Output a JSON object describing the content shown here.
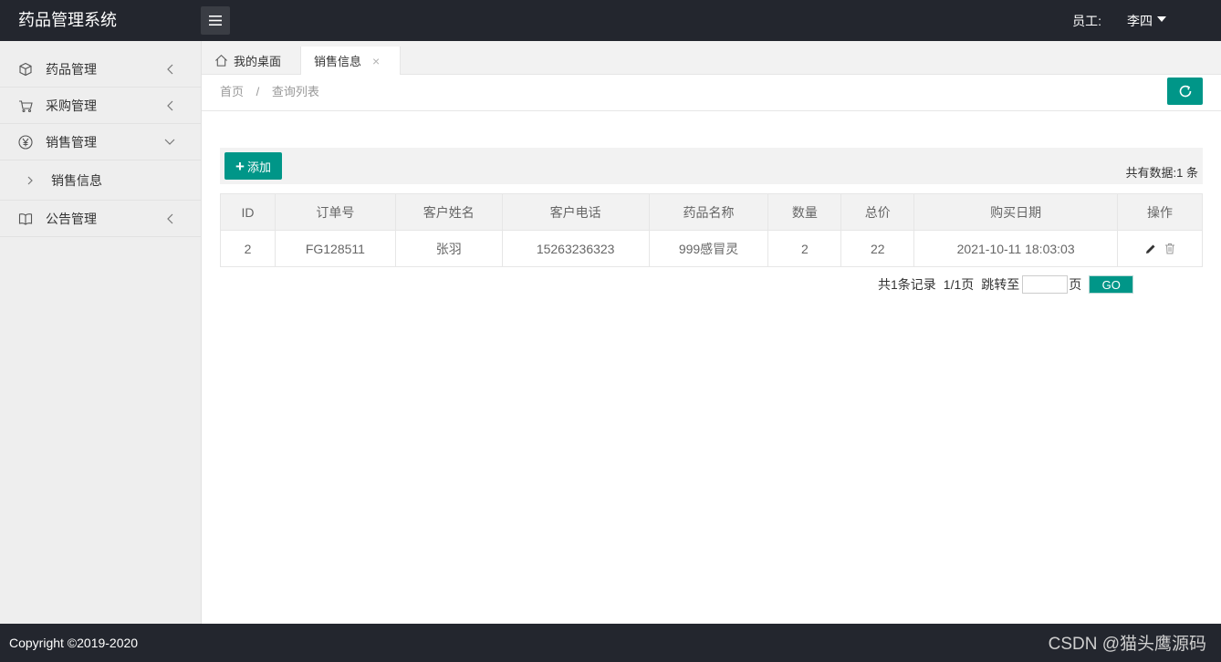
{
  "header": {
    "logo": "药品管理系统",
    "role_label": "员工:",
    "user_name": "李四"
  },
  "sidebar": {
    "items": [
      {
        "label": "药品管理",
        "icon": "cube-icon",
        "arrow": "chevron-left-icon"
      },
      {
        "label": "采购管理",
        "icon": "cart-icon",
        "arrow": "chevron-left-icon"
      },
      {
        "label": "销售管理",
        "icon": "yen-icon",
        "arrow": "chevron-down-icon"
      },
      {
        "label": "公告管理",
        "icon": "book-icon",
        "arrow": "chevron-left-icon"
      }
    ],
    "sub_items": [
      {
        "label": "销售信息",
        "icon": "chevron-right-icon"
      }
    ]
  },
  "tabs": {
    "home_label": "我的桌面",
    "active_label": "销售信息",
    "close_glyph": "×"
  },
  "breadcrumb": {
    "home": "首页",
    "separator": "/",
    "current": "查询列表"
  },
  "toolbar": {
    "add_label": "添加",
    "total_text": "共有数据:1 条"
  },
  "table": {
    "headers": [
      "ID",
      "订单号",
      "客户姓名",
      "客户电话",
      "药品名称",
      "数量",
      "总价",
      "购买日期",
      "操作"
    ],
    "rows": [
      [
        "2",
        "FG128511",
        "张羽",
        "15263236323",
        "999感冒灵",
        "2",
        "22",
        "2021-10-11 18:03:03"
      ]
    ]
  },
  "pagination": {
    "summary": "共1条记录",
    "page_info": "1/1页",
    "jump_label": "跳转至",
    "page_suffix": "页",
    "go_label": "GO",
    "jump_value": ""
  },
  "footer": {
    "copyright": "Copyright ©2019-2020",
    "watermark": "CSDN @猫头鹰源码"
  },
  "colors": {
    "accent": "#009688",
    "header_bg": "#23262e",
    "sidebar_bg": "#eeeeee"
  }
}
